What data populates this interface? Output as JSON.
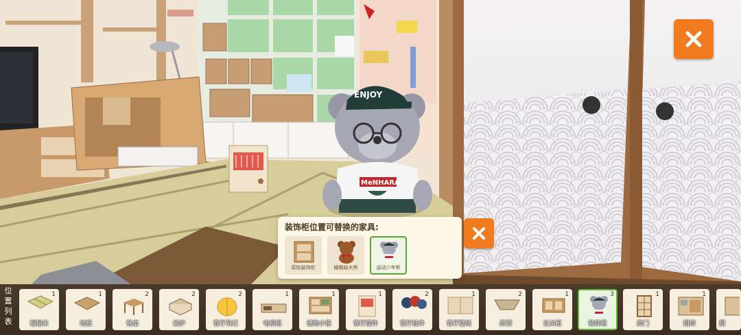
{
  "popup": {
    "title": "装饰柜位置可替换的家具:",
    "options": [
      {
        "label": "原始装饰柜",
        "icon": "cabinet-icon",
        "selected": false
      },
      {
        "label": "蝴蝶结大熊",
        "icon": "bow-bear-icon",
        "selected": false
      },
      {
        "label": "运动少年熊",
        "icon": "sport-bear-icon",
        "selected": true
      }
    ]
  },
  "sidebar_label": "位置列表",
  "scene": {
    "cap_text": "ENJOY",
    "shirt_text": "MeNHARA"
  },
  "items": [
    {
      "name": "榻榻米",
      "count": "1",
      "icon": "tatami-icon",
      "selected": false
    },
    {
      "name": "地板",
      "count": "1",
      "icon": "floor-icon",
      "selected": false
    },
    {
      "name": "餐桌",
      "count": "2",
      "icon": "dining-table-icon",
      "selected": false
    },
    {
      "name": "被炉",
      "count": "2",
      "icon": "kotatsu-icon",
      "selected": false
    },
    {
      "name": "客厅吊灯",
      "count": "2",
      "icon": "lamp-icon",
      "selected": false
    },
    {
      "name": "电视柜",
      "count": "1",
      "icon": "tv-cabinet-icon",
      "selected": false
    },
    {
      "name": "储物小柜",
      "count": "1",
      "icon": "storage-cabinet-icon",
      "selected": false
    },
    {
      "name": "客厅摆件",
      "count": "1",
      "icon": "heater-icon",
      "selected": false
    },
    {
      "name": "客厅挂件",
      "count": "2",
      "icon": "wall-hanging-icon",
      "selected": false
    },
    {
      "name": "客厅壁纸",
      "count": "1",
      "icon": "wallpaper-icon",
      "selected": false
    },
    {
      "name": "房顶",
      "count": "2",
      "icon": "ceiling-icon",
      "selected": false
    },
    {
      "name": "玄关柜",
      "count": "1",
      "icon": "entrance-cabinet-icon",
      "selected": false
    },
    {
      "name": "装饰柜",
      "count": "3",
      "icon": "bear-icon",
      "selected": true
    },
    {
      "name": "房门",
      "count": "1",
      "icon": "door-icon",
      "selected": false
    },
    {
      "name": "厨房",
      "count": "1",
      "icon": "kitchen-icon",
      "selected": false
    },
    {
      "name": "厨",
      "count": "",
      "icon": "partial-item-icon",
      "selected": false
    }
  ]
}
